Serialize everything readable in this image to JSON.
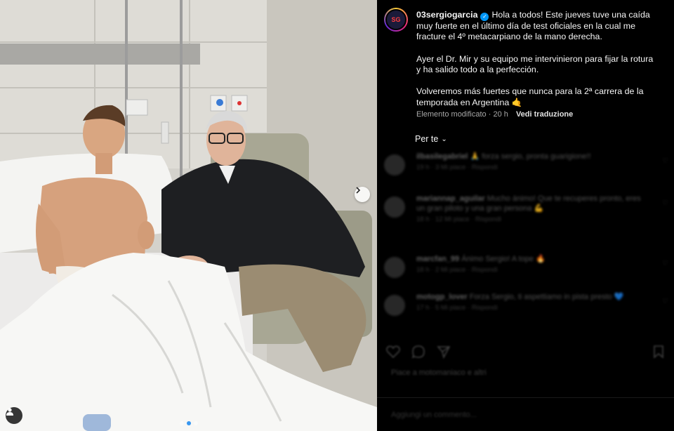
{
  "post": {
    "username": "03sergiogarcia",
    "avatar_initials": "SG",
    "caption_paragraphs": [
      "Hola a todos! Este jueves tuve una caída muy fuerte en el último día de test oficiales en la cual me fracture el 4º metacarpiano de la mano derecha.",
      "Ayer el Dr. Mir y su equipo me intervinieron para fijar la rotura y ha salido todo a la perfección.",
      "Volveremos más fuertes que nunca para la 2ª carrera de la temporada en Argentina 🤙"
    ],
    "edited_label": "Elemento modificato",
    "time_ago": "20 h",
    "translate_label": "Vedi traduzione",
    "sort_label": "Per te",
    "carousel": {
      "current_index": 1,
      "total": 3
    }
  },
  "comments": [
    {
      "user": "ilbasilegabriel",
      "text": "🙏 forza sergio, pronta guarigione!!",
      "time": "19 h",
      "likes": "3 Mi piace",
      "reply": "Rispondi"
    },
    {
      "user": "mariannap_aguilar",
      "text": "Mucho ánimo! Que te recuperes pronto, eres un gran piloto y una gran persona 💪",
      "time": "18 h",
      "likes": "12 Mi piace",
      "reply": "Rispondi"
    },
    {
      "user": "marcfan_99",
      "text": "Ánimo Sergio! A tope 🔥",
      "time": "18 h",
      "likes": "2 Mi piace",
      "reply": "Rispondi"
    },
    {
      "user": "motogp_lover",
      "text": "Forza Sergio, ti aspettiamo in pista presto 💙",
      "time": "17 h",
      "likes": "5 Mi piace",
      "reply": "Rispondi"
    }
  ],
  "likes_text": "Piace a motomaniaco e altri",
  "add_comment_placeholder": "Aggiungi un commento...",
  "icons": [
    "next-arrow-icon",
    "tag-user-icon",
    "verified-badge-icon",
    "chevron-down-icon",
    "heart-icon",
    "comment-icon",
    "share-icon",
    "bookmark-icon"
  ],
  "colors": {
    "accent": "#0095f6",
    "background": "#000000",
    "text": "#f5f5f5",
    "muted": "#a8a8a8"
  }
}
